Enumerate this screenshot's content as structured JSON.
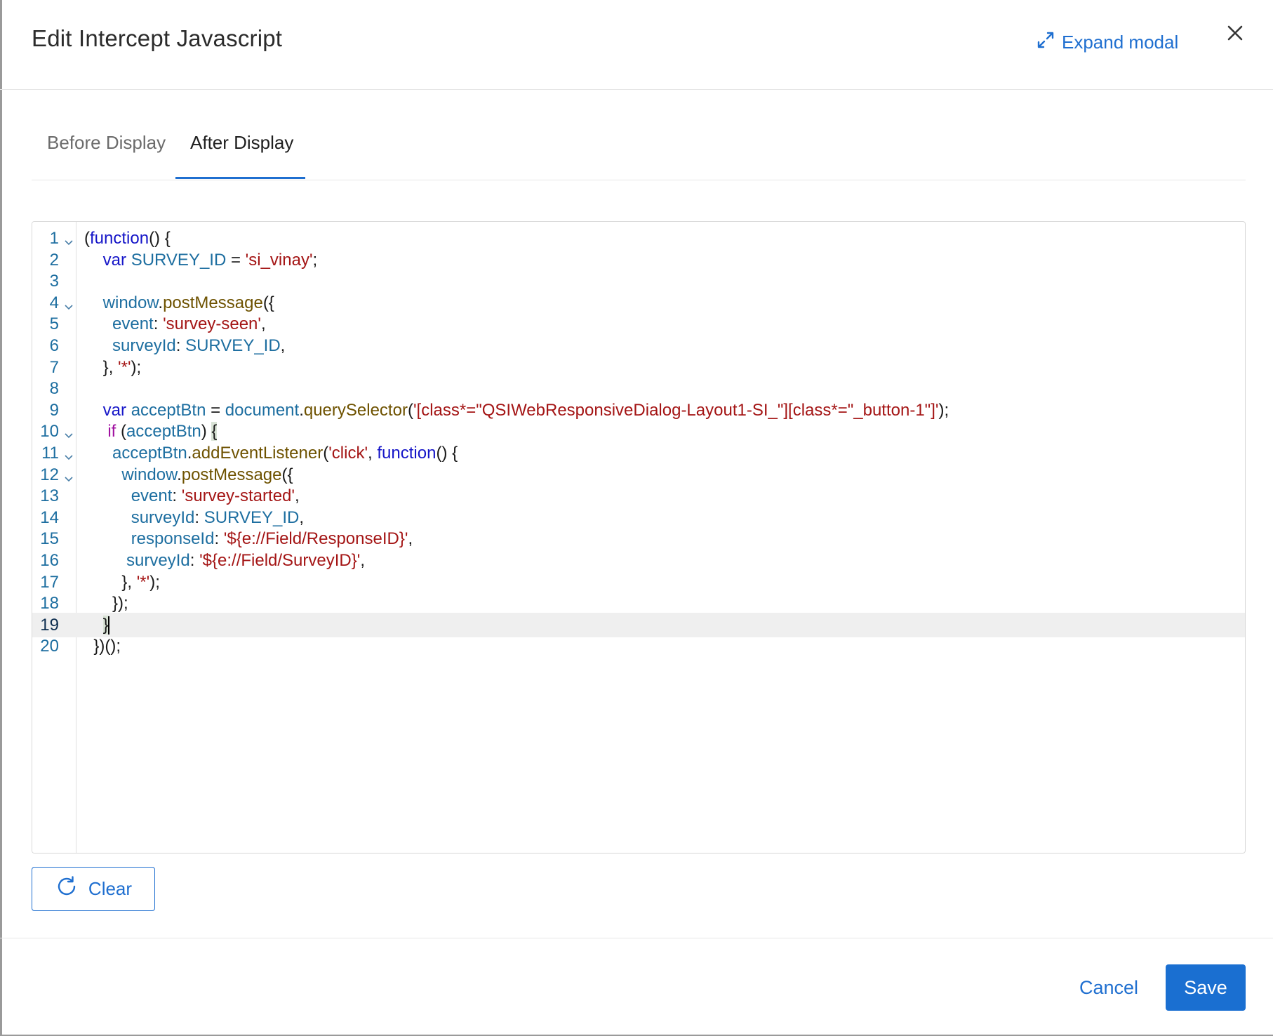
{
  "header": {
    "title": "Edit Intercept Javascript",
    "expand_label": "Expand modal"
  },
  "tabs": [
    {
      "label": "Before Display",
      "active": false
    },
    {
      "label": "After Display",
      "active": true
    }
  ],
  "editor": {
    "line_numbers": [
      "1",
      "2",
      "3",
      "4",
      "5",
      "6",
      "7",
      "8",
      "9",
      "10",
      "11",
      "12",
      "13",
      "14",
      "15",
      "16",
      "17",
      "18",
      "19",
      "20"
    ],
    "current_line": 19,
    "fold_lines": [
      1,
      4,
      10,
      11,
      12
    ],
    "lines": [
      "(function() {",
      "    var SURVEY_ID = 'si_vinay';",
      "",
      "    window.postMessage({",
      "      event: 'survey-seen',",
      "      surveyId: SURVEY_ID,",
      "    }, '*');",
      "",
      "    var acceptBtn = document.querySelector('[class*=\"QSIWebResponsiveDialog-Layout1-SI_\"][class*=\"_button-1\"]');",
      "     if (acceptBtn) {",
      "      acceptBtn.addEventListener('click', function() {",
      "        window.postMessage({",
      "          event: 'survey-started',",
      "          surveyId: SURVEY_ID,",
      "          responseId: '${e://Field/ResponseID}',",
      "         surveyId: '${e://Field/SurveyID}',",
      "        }, '*');",
      "      });",
      "    }",
      "  })();"
    ]
  },
  "clear_label": "Clear",
  "footer": {
    "cancel_label": "Cancel",
    "save_label": "Save"
  },
  "colors": {
    "accent": "#1f6fd0",
    "keyword": "#1515c8",
    "identifier": "#1d6ea0",
    "function": "#6e5200",
    "string": "#a41515"
  }
}
